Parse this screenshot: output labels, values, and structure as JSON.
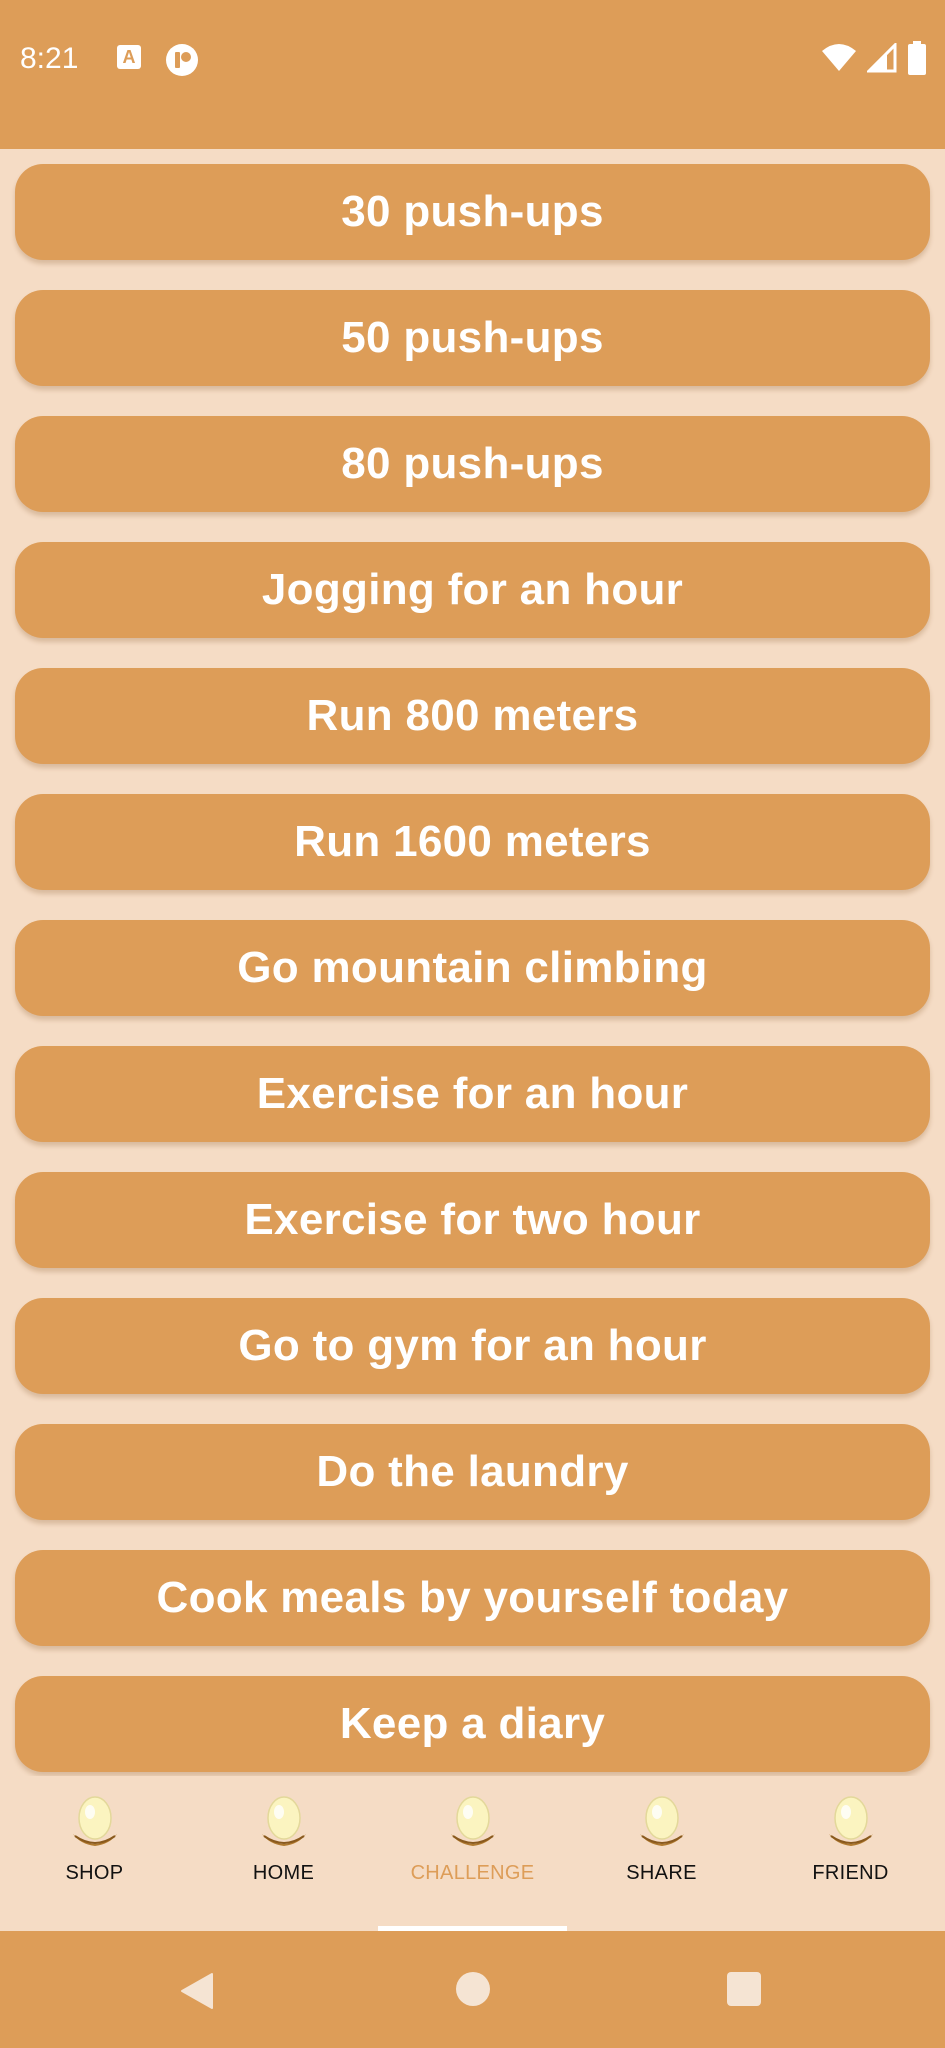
{
  "status_bar": {
    "time": "8:21",
    "icons": [
      "app-a-icon",
      "app-notification-icon",
      "wifi-icon",
      "signal-icon",
      "battery-icon"
    ]
  },
  "challenges": [
    "30 push-ups",
    "50 push-ups",
    "80 push-ups",
    "Jogging for an hour",
    "Run 800 meters",
    "Run 1600 meters",
    "Go mountain climbing",
    "Exercise for an hour",
    "Exercise for two hour",
    "Go to gym for an hour",
    "Do the laundry",
    "Cook meals by yourself today",
    "Keep a diary"
  ],
  "bottom_nav": {
    "items": [
      {
        "label": "SHOP",
        "icon": "egg-nest-icon"
      },
      {
        "label": "HOME",
        "icon": "egg-nest-icon"
      },
      {
        "label": "CHALLENGE",
        "icon": "egg-nest-icon",
        "active": true
      },
      {
        "label": "SHARE",
        "icon": "egg-nest-icon"
      },
      {
        "label": "FRIEND",
        "icon": "egg-nest-icon"
      }
    ]
  },
  "system_nav": {
    "icons": [
      "back-icon",
      "home-icon",
      "recents-icon"
    ]
  },
  "colors": {
    "accent": "#dd9d58",
    "background": "#f5dcc5",
    "active_label": "#dd9d58",
    "text_on_accent": "#ffffff"
  }
}
